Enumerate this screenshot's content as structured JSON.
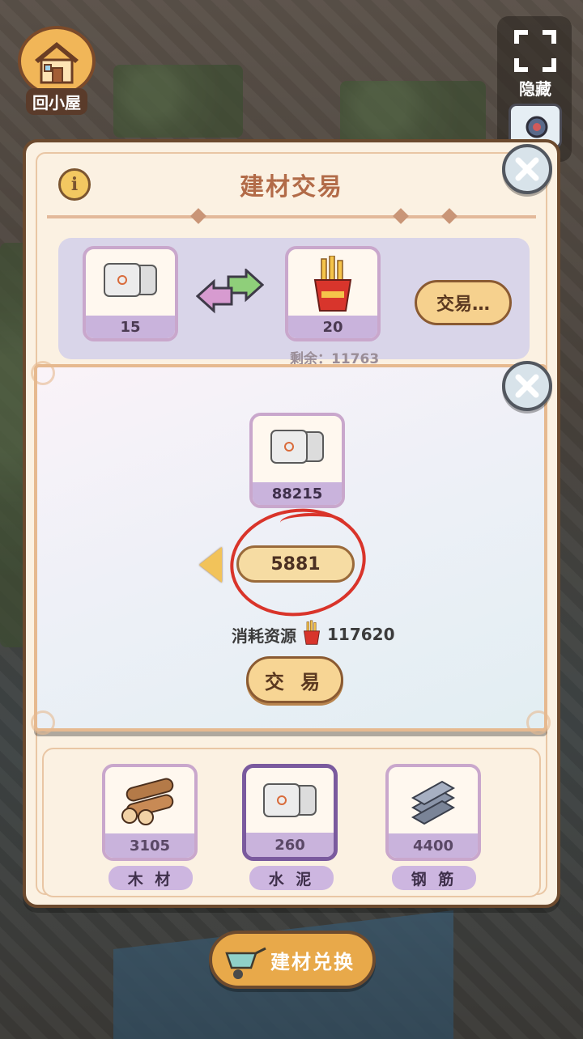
{
  "home": {
    "label": "回小屋"
  },
  "right_controls": {
    "hide_label": "隐藏"
  },
  "panel": {
    "title": "建材交易",
    "trade": {
      "give_count": "15",
      "get_count": "20",
      "button_label": "交易…",
      "remaining": "剩余：11763"
    },
    "categories": [
      {
        "label": "木 材",
        "count": "3105",
        "icon": "wood-logs-icon"
      },
      {
        "label": "水 泥",
        "count": "260",
        "icon": "cement-bags-icon",
        "selected": true
      },
      {
        "label": "钢 筋",
        "count": "4400",
        "icon": "steel-bars-icon"
      }
    ]
  },
  "popup": {
    "item_count": "88215",
    "quantity": "5881",
    "cost_label": "消耗资源",
    "cost_value": "117620",
    "cost_icon": "fries-icon",
    "trade_label": "交 易"
  },
  "exchange_button": {
    "label": "建材兑换"
  },
  "colors": {
    "accent": "#f7d594",
    "panel_bg": "#fbf1e2",
    "slot_border": "#c9a7cc",
    "annotation": "#d9342a"
  }
}
